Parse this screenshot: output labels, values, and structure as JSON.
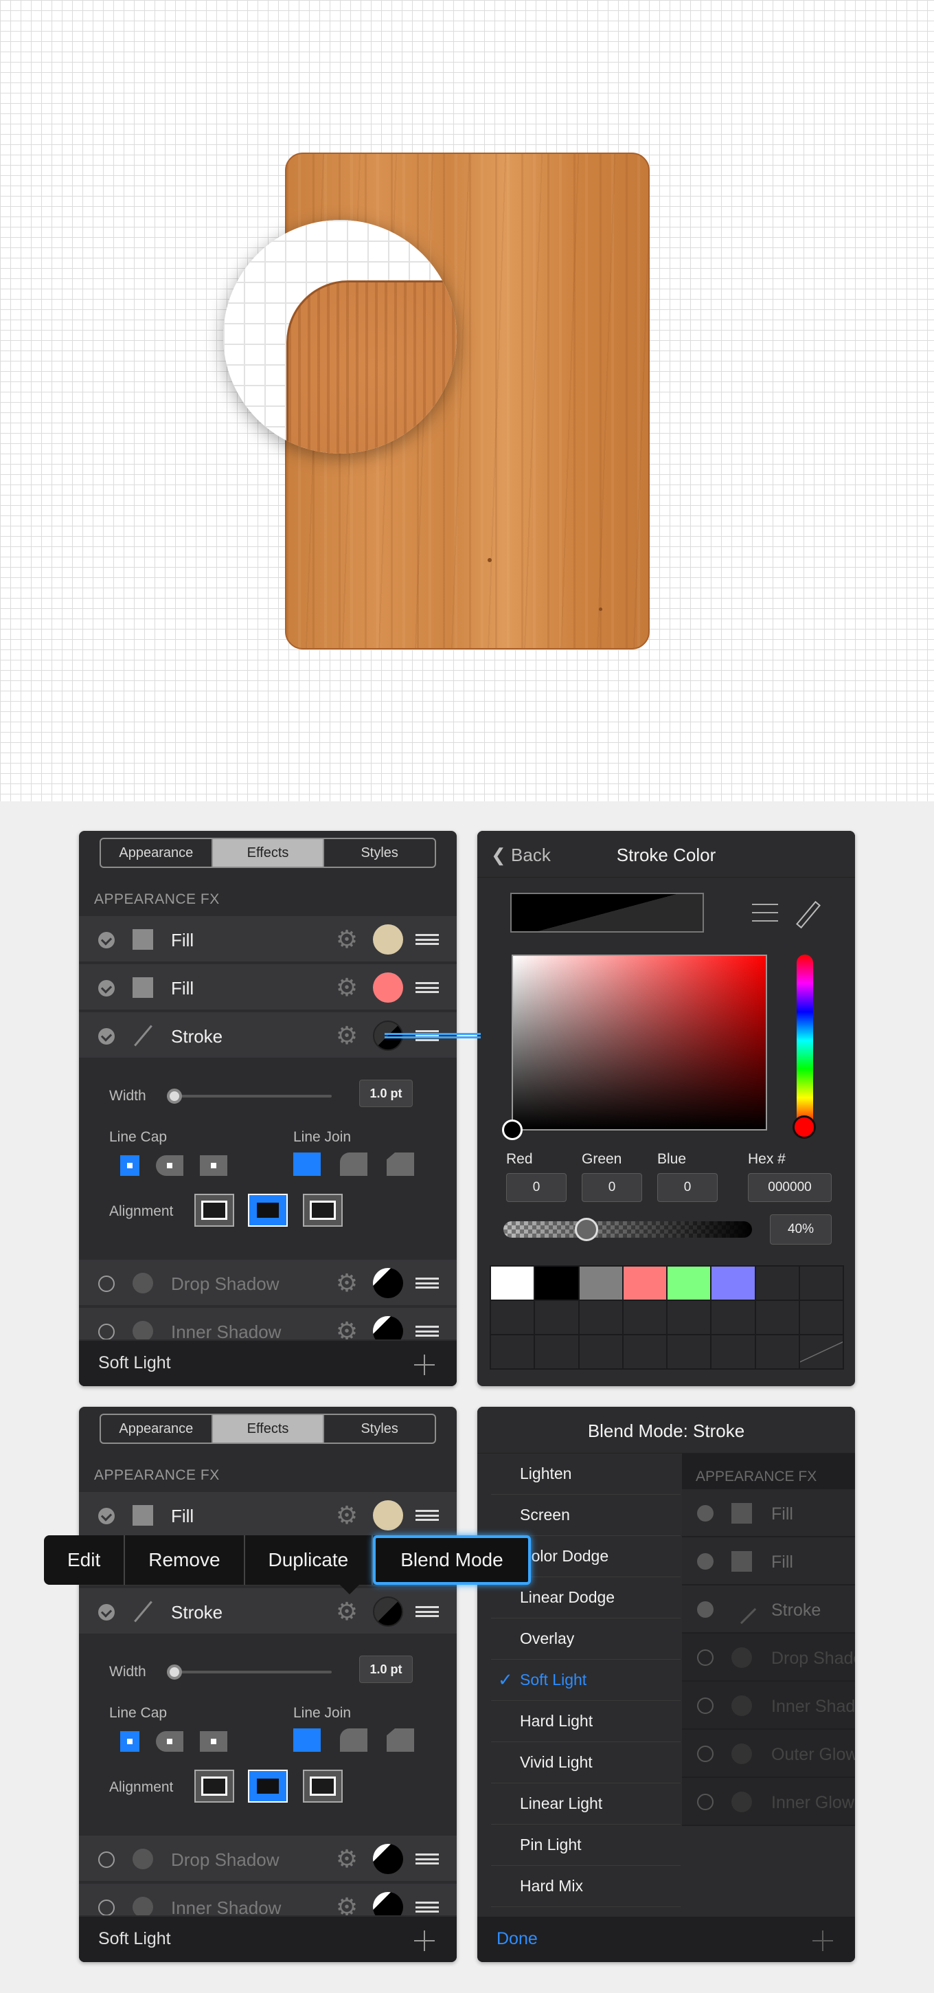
{
  "panel_a": {
    "tabs": [
      "Appearance",
      "Effects",
      "Styles"
    ],
    "active_tab": "Effects",
    "section_label": "APPEARANCE FX",
    "rows": [
      {
        "label": "Fill",
        "enabled": true,
        "swatch": "#dbcba6"
      },
      {
        "label": "Fill",
        "enabled": true,
        "swatch": "#ff7b7b"
      },
      {
        "label": "Stroke",
        "enabled": true,
        "swatch": "#000000"
      }
    ],
    "width_label": "Width",
    "width_value": "1.0 pt",
    "line_cap_label": "Line Cap",
    "line_join_label": "Line Join",
    "alignment_label": "Alignment",
    "lower_rows": [
      {
        "label": "Drop Shadow",
        "enabled": false
      },
      {
        "label": "Inner Shadow",
        "enabled": false
      }
    ],
    "footer_label": "Soft Light"
  },
  "stroke_color": {
    "back_label": "Back",
    "title": "Stroke Color",
    "fields": {
      "red_label": "Red",
      "red": "0",
      "green_label": "Green",
      "green": "0",
      "blue_label": "Blue",
      "blue": "0",
      "hex_label": "Hex #",
      "hex": "000000"
    },
    "opacity": "40%",
    "swatches": [
      "#ffffff",
      "#000000",
      "#808080",
      "#ff7b7b",
      "#7fff7f",
      "#7f7fff"
    ]
  },
  "context_menu": {
    "items": [
      "Edit",
      "Remove",
      "Duplicate",
      "Blend Mode"
    ],
    "highlighted": "Blend Mode"
  },
  "blend_mode": {
    "title": "Blend Mode: Stroke",
    "modes": [
      "Lighten",
      "Screen",
      "Color Dodge",
      "Linear Dodge",
      "Overlay",
      "Soft Light",
      "Hard Light",
      "Vivid Light",
      "Linear Light",
      "Pin Light",
      "Hard Mix"
    ],
    "selected": "Soft Light",
    "side_section": "APPEARANCE FX",
    "side_rows": [
      "Fill",
      "Fill",
      "Stroke",
      "Drop Shadow",
      "Inner Shadow",
      "Outer Glow",
      "Inner Glow"
    ],
    "done_label": "Done"
  },
  "colors": {
    "accent": "#1c80ff",
    "panel_bg": "#2c2c2e",
    "wood": "#d08846"
  }
}
